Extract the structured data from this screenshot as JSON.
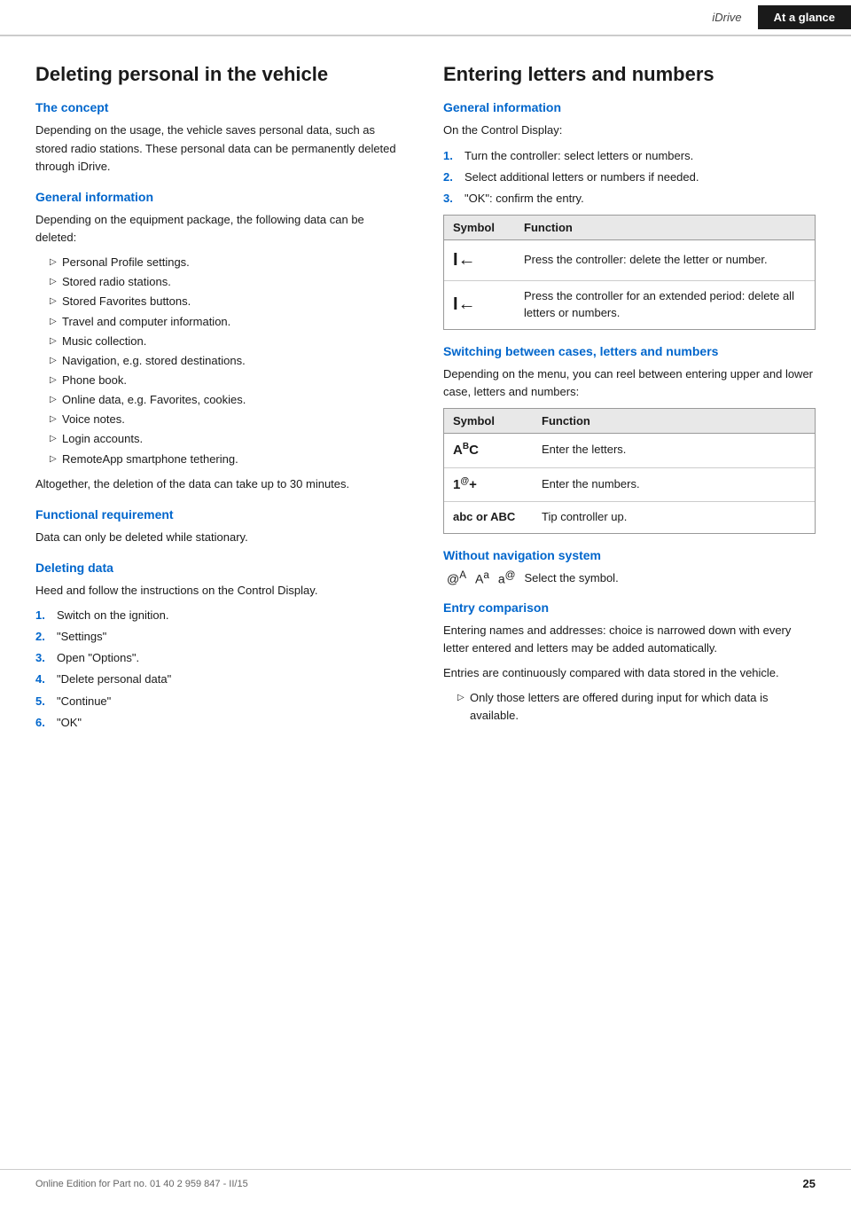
{
  "header": {
    "idrive_label": "iDrive",
    "tab_active": "At a glance"
  },
  "left_section": {
    "title": "Deleting personal in the vehicle",
    "concept": {
      "heading": "The concept",
      "text": "Depending on the usage, the vehicle saves personal data, such as stored radio stations. These personal data can be permanently deleted through iDrive."
    },
    "general_info": {
      "heading": "General information",
      "intro": "Depending on the equipment package, the following data can be deleted:",
      "items": [
        "Personal Profile settings.",
        "Stored radio stations.",
        "Stored Favorites buttons.",
        "Travel and computer information.",
        "Music collection.",
        "Navigation, e.g. stored destinations.",
        "Phone book.",
        "Online data, e.g. Favorites, cookies.",
        "Voice notes.",
        "Login accounts.",
        "RemoteApp smartphone tethering."
      ],
      "note": "Altogether, the deletion of the data can take up to 30 minutes."
    },
    "functional_req": {
      "heading": "Functional requirement",
      "text": "Data can only be deleted while stationary."
    },
    "deleting_data": {
      "heading": "Deleting data",
      "intro": "Heed and follow the instructions on the Control Display.",
      "steps": [
        {
          "num": "1.",
          "text": "Switch on the ignition."
        },
        {
          "num": "2.",
          "text": "\"Settings\""
        },
        {
          "num": "3.",
          "text": "Open \"Options\"."
        },
        {
          "num": "4.",
          "text": "\"Delete personal data\""
        },
        {
          "num": "5.",
          "text": "\"Continue\""
        },
        {
          "num": "6.",
          "text": "\"OK\""
        }
      ]
    }
  },
  "right_section": {
    "title": "Entering letters and numbers",
    "general_info": {
      "heading": "General information",
      "intro": "On the Control Display:",
      "steps": [
        {
          "num": "1.",
          "text": "Turn the controller: select letters or numbers."
        },
        {
          "num": "2.",
          "text": "Select additional letters or numbers if needed."
        },
        {
          "num": "3.",
          "text": "\"OK\": confirm the entry."
        }
      ]
    },
    "table1": {
      "col1_header": "Symbol",
      "col2_header": "Function",
      "rows": [
        {
          "symbol": "I←",
          "function": "Press the controller: delete the letter or number."
        },
        {
          "symbol": "I←",
          "function": "Press the controller for an extended period: delete all letters or numbers."
        }
      ]
    },
    "switching": {
      "heading": "Switching between cases, letters and numbers",
      "text": "Depending on the menu, you can reel between entering upper and lower case, letters and numbers:",
      "table": {
        "col1_header": "Symbol",
        "col2_header": "Function",
        "rows": [
          {
            "symbol": "Aᴬᶜ",
            "function": "Enter the letters."
          },
          {
            "symbol": "1@+",
            "function": "Enter the numbers."
          },
          {
            "symbol": "abc or ABC",
            "function": "Tip controller up."
          }
        ]
      }
    },
    "without_nav": {
      "heading": "Without navigation system",
      "symbols": "@A  Aᵃ  aᵅ",
      "text": "Select the symbol."
    },
    "entry_comparison": {
      "heading": "Entry comparison",
      "text1": "Entering names and addresses: choice is narrowed down with every letter entered and letters may be added automatically.",
      "text2": "Entries are continuously compared with data stored in the vehicle.",
      "bullet": "Only those letters are offered during input for which data is available."
    }
  },
  "footer": {
    "text": "Online Edition for Part no. 01 40 2 959 847 - II/15",
    "page": "25"
  }
}
